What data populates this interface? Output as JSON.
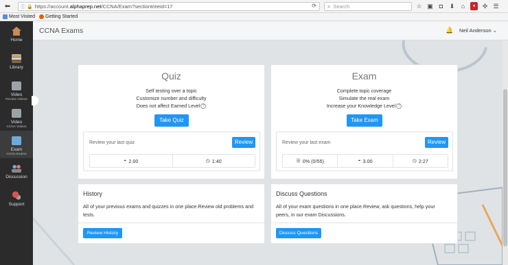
{
  "browser": {
    "url_prefix": "https://account.",
    "url_domain": "alphaprep.net",
    "url_path": "/CCNA/Exam?sectiontreeid=17",
    "search_placeholder": "Search",
    "bookmarks": [
      "Most Visited",
      "Getting Started"
    ]
  },
  "header": {
    "title": "CCNA Exams",
    "user": "Neil Anderson",
    "user_caret": "⌄"
  },
  "sidebar": {
    "items": [
      {
        "label": "Home",
        "sub": ""
      },
      {
        "label": "Library",
        "sub": ""
      },
      {
        "label": "Video",
        "sub": "Review Videos"
      },
      {
        "label": "Video",
        "sub": "CCNA Videos"
      },
      {
        "label": "Exam",
        "sub": "CCNA Exams"
      },
      {
        "label": "Discussion",
        "sub": ""
      },
      {
        "label": "Support",
        "sub": ""
      }
    ]
  },
  "quiz": {
    "title": "Quiz",
    "line1": "Self testing over a topic",
    "line2": "Customize number and difficulty",
    "line3": "Does not affect Earned Level",
    "button": "Take Quiz",
    "review_label": "Review your last quiz",
    "review_button": "Review",
    "stat_difficulty": "2.00",
    "stat_time": "1:40"
  },
  "exam": {
    "title": "Exam",
    "line1": "Complete topic coverage",
    "line2": "Simulate the real exam",
    "line3": "Increase your Knowledge Level",
    "button": "Take Exam",
    "review_label": "Review your last exam",
    "review_button": "Review",
    "stat_score": "0% (0/55)",
    "stat_difficulty": "3.00",
    "stat_time": "2:27"
  },
  "history": {
    "title": "History",
    "text": "All of your previous exams and quizzes in one place.Review old problems and tests.",
    "button": "Review History"
  },
  "discuss": {
    "title": "Discuss Questions",
    "text": "All of your exam questions in one place.Review, ask questions, help your peers, in our exam Discussions.",
    "button": "Discuss Questions"
  },
  "colors": {
    "accent": "#2196f3",
    "sidebar": "#2b2b2b"
  }
}
